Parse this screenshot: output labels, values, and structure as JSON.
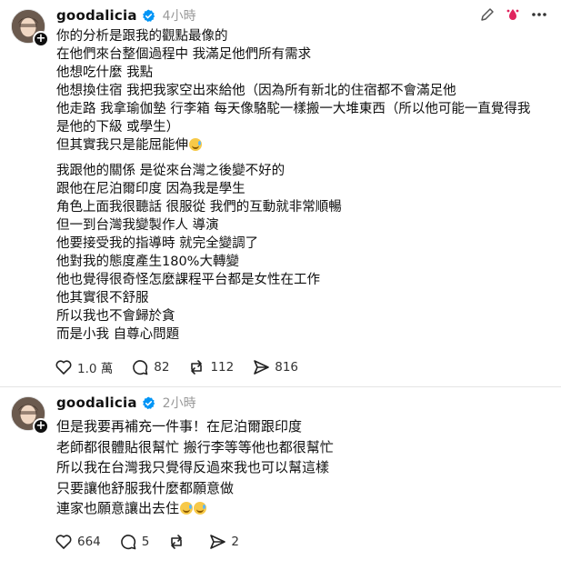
{
  "posts": [
    {
      "username": "goodalicia",
      "time": "4小時",
      "paragraphs": [
        [
          "你的分析是跟我的觀點最像的",
          "在他們來台整個過程中 我滿足他們所有需求",
          "他想吃什麼 我點",
          "他想換住宿 我把我家空出來給他（因為所有新北的住宿都不會滿足他",
          "他走路 我拿瑜伽墊 行李箱 每天像駱駝一樣搬一大堆東西（所以他可能一直覺得我",
          "是他的下級 或學生）",
          "但其實我只是能屈能伸"
        ],
        [
          "我跟他的關係 是從來台灣之後變不好的",
          "跟他在尼泊爾印度 因為我是學生",
          "角色上面我很聽話 很服從 我們的互動就非常順暢",
          "但一到台灣我變製作人 導演",
          "他要接受我的指導時 就完全變調了",
          "他對我的態度產生180%大轉變",
          "他也覺得很奇怪怎麼課程平台都是女性在工作",
          "他其實很不舒服",
          "所以我也不會歸於貪",
          "而是小我 自尊心問題"
        ]
      ],
      "stats": {
        "likes": "1.0 萬",
        "comments": "82",
        "reposts": "112",
        "shares": "816"
      }
    },
    {
      "username": "goodalicia",
      "time": "2小時",
      "paragraphs": [
        [
          "但是我要再補充一件事！在尼泊爾跟印度",
          "老師都很體貼很幫忙 搬行李等等他也都很幫忙",
          "所以我在台灣我只覺得反過來我也可以幫這樣",
          "只要讓他舒服我什麼都願意做",
          "連家也願意讓出去住"
        ]
      ],
      "stats": {
        "likes": "664",
        "comments": "5",
        "reposts": "",
        "shares": "2"
      }
    }
  ],
  "icons": {
    "verified": "verified-badge-icon",
    "edit": "pencil-icon",
    "reaction": "heart-drop-icon",
    "more": "more-icon",
    "like": "heart-icon",
    "comment": "comment-icon",
    "repost": "repost-icon",
    "share": "share-icon",
    "emoji": "grin-sweat-emoji-icon"
  },
  "colors": {
    "verified": "#0095f6",
    "heart_accent": "#e0245e",
    "muted_text": "#999999"
  }
}
